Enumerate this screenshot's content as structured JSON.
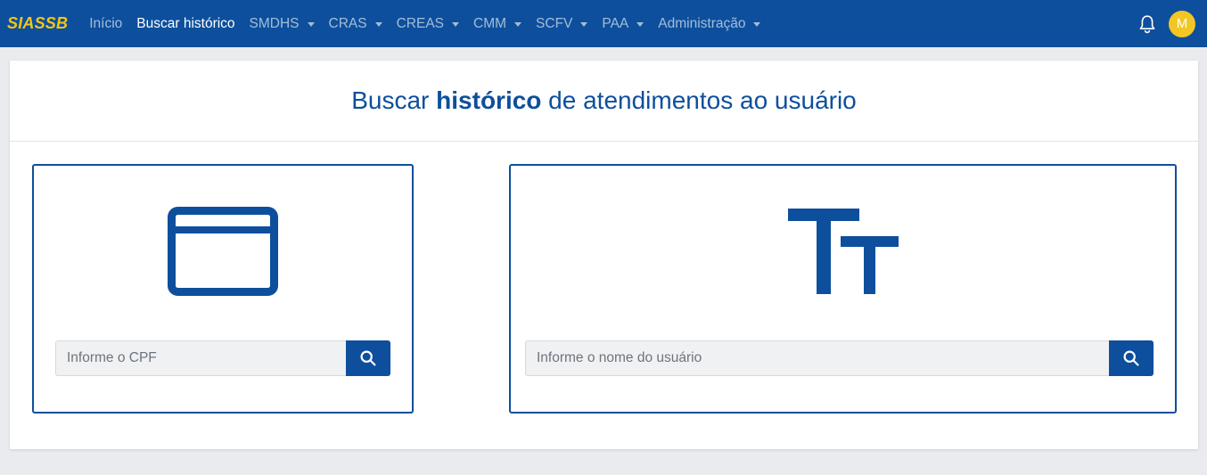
{
  "navbar": {
    "brand": "SIASSB",
    "items": [
      {
        "label": "Início",
        "dropdown": false,
        "active": false
      },
      {
        "label": "Buscar histórico",
        "dropdown": false,
        "active": true
      },
      {
        "label": "SMDHS",
        "dropdown": true,
        "active": false
      },
      {
        "label": "CRAS",
        "dropdown": true,
        "active": false
      },
      {
        "label": "CREAS",
        "dropdown": true,
        "active": false
      },
      {
        "label": "CMM",
        "dropdown": true,
        "active": false
      },
      {
        "label": "SCFV",
        "dropdown": true,
        "active": false
      },
      {
        "label": "PAA",
        "dropdown": true,
        "active": false
      },
      {
        "label": "Administração",
        "dropdown": true,
        "active": false
      }
    ],
    "notifications_icon": "bell-icon",
    "avatar_initial": "M"
  },
  "main": {
    "title_prefix": "Buscar ",
    "title_bold": "histórico",
    "title_suffix": " de atendimentos ao usuário",
    "cpf_search": {
      "icon": "credit-card-icon",
      "placeholder": "Informe o CPF",
      "value": "",
      "button_icon": "search-icon"
    },
    "name_search": {
      "icon": "text-size-icon",
      "placeholder": "Informe o nome do usuário",
      "value": "",
      "button_icon": "search-icon"
    }
  },
  "colors": {
    "primary": "#0d4f9c",
    "brand": "#f5c518",
    "avatar": "#f3c623",
    "background": "#e9ebee"
  }
}
